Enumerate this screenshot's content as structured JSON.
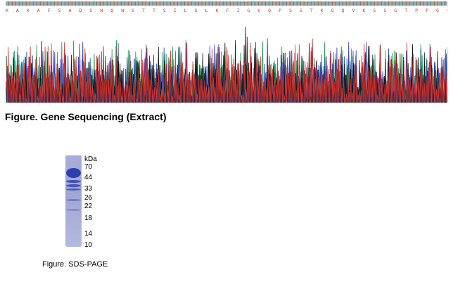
{
  "sequencing": {
    "aa_sequence": "K A K A F S A D S N Q N S T T S I L S L K F I G V Q P S S T K Q Q V K S S G T P P G S P H F Q T T S A S T E H D L P K F K S D L S D D A F P S N N S L P K F L S S H T S L S R",
    "caption": "Figure. Gene Sequencing (Extract)",
    "trace_colors": {
      "A": "#1f9a55",
      "C": "#2b3fb5",
      "G": "#111111",
      "T": "#d0302a"
    }
  },
  "gel": {
    "unit": "kDa",
    "markers": [
      "70",
      "44",
      "33",
      "26",
      "22",
      "18",
      "14",
      "10"
    ],
    "caption": "Figure. SDS-PAGE",
    "lane_color": "#9fa6d3",
    "band_color": "#2d3fb0"
  }
}
